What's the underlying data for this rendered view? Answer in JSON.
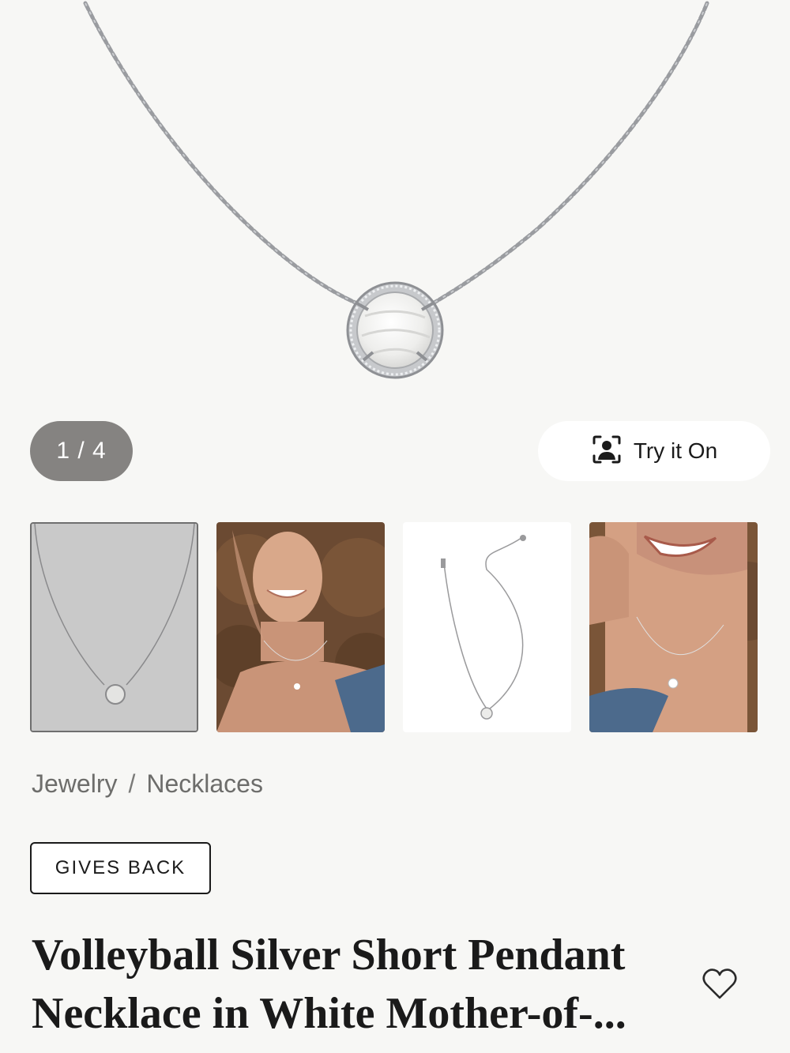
{
  "gallery": {
    "counter": "1 / 4",
    "try_on_label": "Try it On",
    "thumbnails": [
      {
        "name": "product-front"
      },
      {
        "name": "model-smiling"
      },
      {
        "name": "full-chain-laid-out"
      },
      {
        "name": "model-closeup"
      }
    ]
  },
  "breadcrumb": {
    "level1": "Jewelry",
    "separator": "/",
    "level2": "Necklaces"
  },
  "badge": {
    "label": "GIVES BACK"
  },
  "product": {
    "title_line1": "Volleyball Silver Short Pendant",
    "title_line2": "Necklace in White Mother-of-..."
  },
  "icons": {
    "try_on": "face-scan-icon",
    "wishlist": "heart-icon"
  },
  "colors": {
    "background": "#f7f7f5",
    "counter_pill": "#858381",
    "text": "#1a1a1a",
    "breadcrumb": "#7a7a78"
  }
}
